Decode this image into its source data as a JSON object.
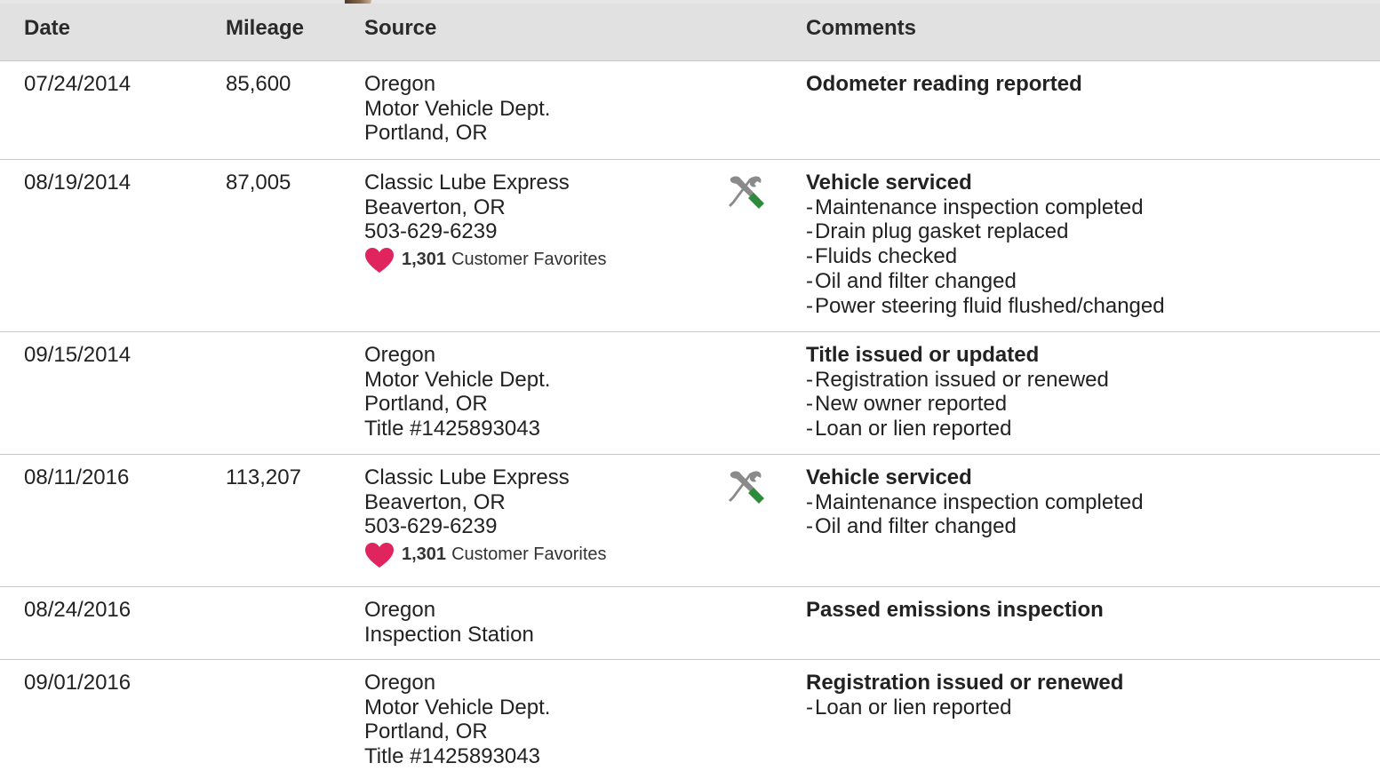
{
  "headers": {
    "date": "Date",
    "mileage": "Mileage",
    "source": "Source",
    "comments": "Comments"
  },
  "colors": {
    "heart": "#e0245e",
    "tool_gray": "#8a8a8a",
    "tool_green": "#2e8b3d",
    "header_bg": "#e1e1e1"
  },
  "rows": [
    {
      "date": "07/24/2014",
      "mileage": "85,600",
      "source": [
        "Oregon",
        "Motor Vehicle Dept.",
        "Portland, OR"
      ],
      "comment_title": "Odometer reading reported",
      "comment_items": []
    },
    {
      "date": "08/19/2014",
      "mileage": "87,005",
      "source": [
        "Classic Lube Express",
        "Beaverton, OR",
        "503-629-6239"
      ],
      "favorites_count": "1,301",
      "favorites_label": "Customer Favorites",
      "icon": "service-tools-icon",
      "comment_title": "Vehicle serviced",
      "comment_items": [
        "Maintenance inspection completed",
        "Drain plug gasket replaced",
        "Fluids checked",
        "Oil and filter changed",
        "Power steering fluid flushed/changed"
      ]
    },
    {
      "date": "09/15/2014",
      "mileage": "",
      "source": [
        "Oregon",
        "Motor Vehicle Dept.",
        "Portland, OR",
        "Title #1425893043"
      ],
      "comment_title": "Title issued or updated",
      "comment_items": [
        "Registration issued or renewed",
        "New owner reported",
        "Loan or lien reported"
      ]
    },
    {
      "date": "08/11/2016",
      "mileage": "113,207",
      "source": [
        "Classic Lube Express",
        "Beaverton, OR",
        "503-629-6239"
      ],
      "favorites_count": "1,301",
      "favorites_label": "Customer Favorites",
      "icon": "service-tools-icon",
      "comment_title": "Vehicle serviced",
      "comment_items": [
        "Maintenance inspection completed",
        "Oil and filter changed"
      ]
    },
    {
      "date": "08/24/2016",
      "mileage": "",
      "source": [
        "Oregon",
        "Inspection Station"
      ],
      "comment_title": "Passed emissions inspection",
      "comment_items": []
    },
    {
      "date": "09/01/2016",
      "mileage": "",
      "source": [
        "Oregon",
        "Motor Vehicle Dept.",
        "Portland, OR",
        "Title #1425893043"
      ],
      "comment_title": "Registration issued or renewed",
      "comment_items": [
        "Loan or lien reported"
      ]
    }
  ]
}
